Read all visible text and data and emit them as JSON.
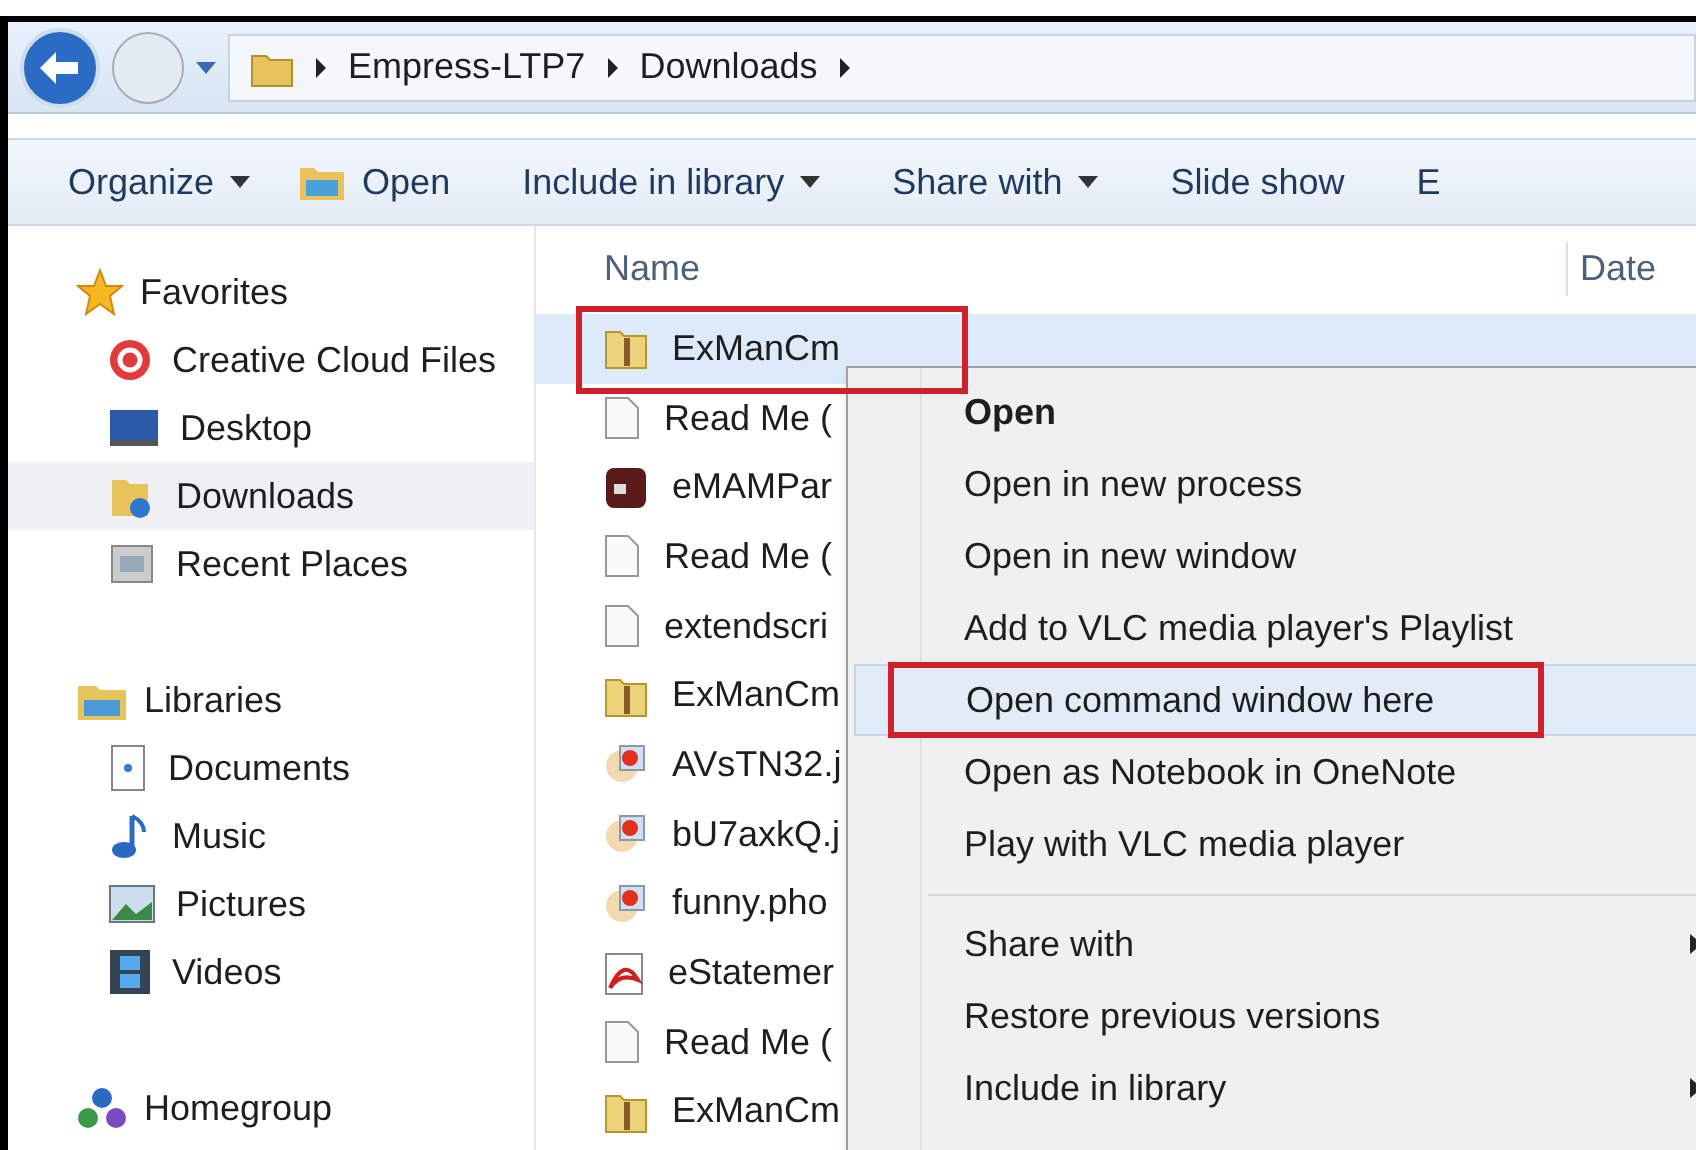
{
  "address_bar": {
    "path": [
      "Empress-LTP7",
      "Downloads"
    ]
  },
  "toolbar": [
    {
      "label": "Organize",
      "dropdown": true
    },
    {
      "label": "Open",
      "dropdown": false
    },
    {
      "label": "Include in library",
      "dropdown": true
    },
    {
      "label": "Share with",
      "dropdown": true
    },
    {
      "label": "Slide show",
      "dropdown": false
    },
    {
      "label": "E",
      "dropdown": false
    }
  ],
  "sidebar": [
    {
      "label": "Favorites",
      "children": [
        {
          "label": "Creative Cloud Files",
          "selected": false
        },
        {
          "label": "Desktop",
          "selected": false
        },
        {
          "label": "Downloads",
          "selected": true
        },
        {
          "label": "Recent Places",
          "selected": false
        }
      ]
    },
    {
      "label": "Libraries",
      "children": [
        {
          "label": "Documents",
          "selected": false
        },
        {
          "label": "Music",
          "selected": false
        },
        {
          "label": "Pictures",
          "selected": false
        },
        {
          "label": "Videos",
          "selected": false
        }
      ]
    },
    {
      "label": "Homegroup"
    }
  ],
  "columns": [
    "Name",
    "Date"
  ],
  "files": [
    {
      "name": "ExManCm",
      "selected": true,
      "annotated": true
    },
    {
      "name": "Read Me (",
      "selected": false,
      "annotated": false
    },
    {
      "name": "eMAMPar",
      "selected": false,
      "annotated": false
    },
    {
      "name": "Read Me (",
      "selected": false,
      "annotated": false
    },
    {
      "name": "extendscri",
      "selected": false,
      "annotated": false
    },
    {
      "name": "ExManCm",
      "selected": false,
      "annotated": false
    },
    {
      "name": "AVsTN32.j",
      "selected": false,
      "annotated": false
    },
    {
      "name": "bU7axkQ.j",
      "selected": false,
      "annotated": false
    },
    {
      "name": "funny.pho",
      "selected": false,
      "annotated": false
    },
    {
      "name": "eStatemer",
      "selected": false,
      "annotated": false
    },
    {
      "name": "Read Me (",
      "selected": false,
      "annotated": false
    },
    {
      "name": "ExManCm",
      "selected": false,
      "annotated": false
    }
  ],
  "context_menu": [
    {
      "kind": "item",
      "label": "Open",
      "default": true,
      "submenu": false,
      "selected": false,
      "annotated": false
    },
    {
      "kind": "item",
      "label": "Open in new process",
      "default": false,
      "submenu": false,
      "selected": false,
      "annotated": false
    },
    {
      "kind": "item",
      "label": "Open in new window",
      "default": false,
      "submenu": false,
      "selected": false,
      "annotated": false
    },
    {
      "kind": "item",
      "label": "Add to VLC media player's Playlist",
      "default": false,
      "submenu": false,
      "selected": false,
      "annotated": false
    },
    {
      "kind": "item",
      "label": "Open command window here",
      "default": false,
      "submenu": false,
      "selected": true,
      "annotated": true
    },
    {
      "kind": "item",
      "label": "Open as Notebook in OneNote",
      "default": false,
      "submenu": false,
      "selected": false,
      "annotated": false
    },
    {
      "kind": "item",
      "label": "Play with VLC media player",
      "default": false,
      "submenu": false,
      "selected": false,
      "annotated": false
    },
    {
      "kind": "separator"
    },
    {
      "kind": "item",
      "label": "Share with",
      "default": false,
      "submenu": true,
      "selected": false,
      "annotated": false
    },
    {
      "kind": "item",
      "label": "Restore previous versions",
      "default": false,
      "submenu": false,
      "selected": false,
      "annotated": false
    },
    {
      "kind": "item",
      "label": "Include in library",
      "default": false,
      "submenu": true,
      "selected": false,
      "annotated": false
    }
  ]
}
